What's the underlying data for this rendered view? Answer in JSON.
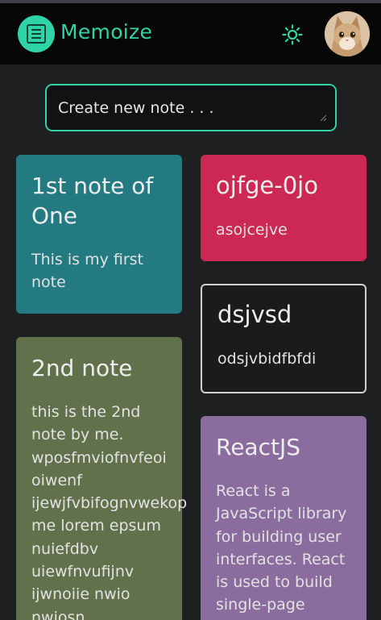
{
  "app": {
    "title": "Memoize"
  },
  "header": {
    "theme_icon": "sun-icon",
    "avatar_icon": "cat-avatar"
  },
  "create": {
    "placeholder": "Create new note . . ."
  },
  "notes": [
    {
      "title": "1st note of One",
      "body": "This is my first note",
      "color": "#237b81"
    },
    {
      "title": "2nd note",
      "body": "this is the 2nd note by me. wposfmviofnvfeoi oiwenf ijewjfvbifognvwekop me lorem epsum nuiefdbv uiewfnvufijnv ijwnoiie nwio nwiosn",
      "color": "#60714b"
    },
    {
      "title": "ojfge-0jo",
      "body": "asojcejve",
      "color": "#cb2953"
    },
    {
      "title": "dsjvsd",
      "body": "odsjvbidfbfdi",
      "color": "#1a1b1c"
    },
    {
      "title": "ReactJS",
      "body": "React is a JavaScript library for building user interfaces. React is used to build single-page",
      "color": "#8a6c9e"
    }
  ],
  "colors": {
    "accent": "#2ed4a6",
    "background": "#1e1f20",
    "header": "#070707"
  }
}
